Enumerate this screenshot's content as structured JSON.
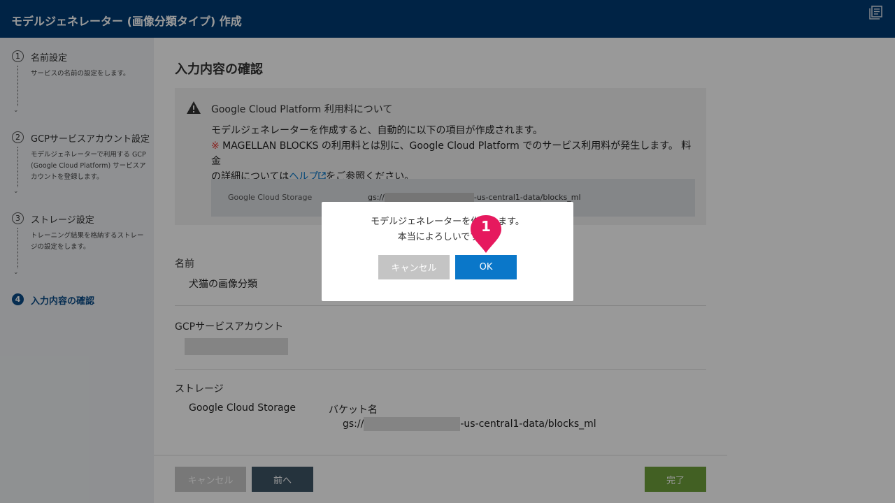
{
  "header": {
    "title": "モデルジェネレーター (画像分類タイプ) 作成",
    "icon": "document-list-icon"
  },
  "sidebar": {
    "steps": [
      {
        "num": "1",
        "title": "名前設定",
        "desc": "サービスの名前の設定をします。"
      },
      {
        "num": "2",
        "title": "GCPサービスアカウント設定",
        "desc": "モデルジェネレーターで利用する GCP (Google Cloud Platform) サービスアカウントを登録します。"
      },
      {
        "num": "3",
        "title": "ストレージ設定",
        "desc": "トレーニング結果を格納するストレージの設定をします。"
      },
      {
        "num": "4",
        "title": "入力内容の確認",
        "desc": ""
      }
    ],
    "active_step": 4
  },
  "main": {
    "title": "入力内容の確認",
    "notice": {
      "heading": "Google Cloud Platform 利用料について",
      "line1": "モデルジェネレーターを作成すると、自動的に以下の項目が作成されます。",
      "mark": "※",
      "line2": " MAGELLAN BLOCKS の利用料とは別に、Google Cloud Platform でのサービス利用料が発生します。 料金",
      "line3_pre": "の詳細については",
      "link": "ヘルプ",
      "line3_post": "をご参照ください。",
      "table_label": "Google Cloud Storage",
      "table_prefix": "gs://",
      "table_suffix": "-us-central1-data/blocks_ml"
    },
    "name_label": "名前",
    "name_value": "犬猫の画像分類",
    "gcp_label": "GCPサービスアカウント",
    "storage_label": "ストレージ",
    "storage_type": "Google Cloud Storage",
    "bucket_label": "バケット名",
    "bucket_prefix": "gs://",
    "bucket_suffix": "-us-central1-data/blocks_ml"
  },
  "footer": {
    "cancel": "キャンセル",
    "back": "前へ",
    "finish": "完了"
  },
  "dialog": {
    "line1": "モデルジェネレーターを作成します。",
    "line2": "本当によろしいですか？",
    "cancel": "キャンセル",
    "ok": "OK"
  },
  "badge": {
    "number": "1",
    "color": "#e6195e"
  },
  "colors": {
    "header": "#003b73",
    "primary": "#0a77c9",
    "finish": "#6ea13b",
    "back": "#3f5567"
  }
}
